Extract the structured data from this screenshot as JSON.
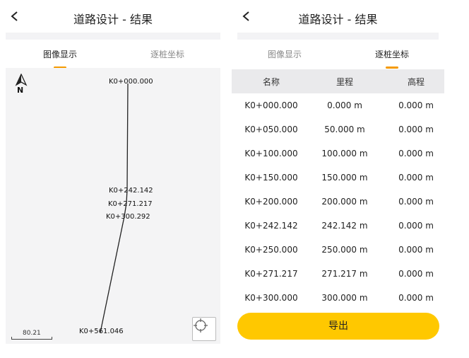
{
  "left": {
    "title": "道路设计 - 结果",
    "tabs": [
      {
        "label": "图像显示",
        "active": true
      },
      {
        "label": "逐桩坐标",
        "active": false
      }
    ],
    "map": {
      "north_label": "N",
      "stations": [
        {
          "label": "K0+000.000"
        },
        {
          "label": "K0+242.142"
        },
        {
          "label": "K0+271.217"
        },
        {
          "label": "K0+300.292"
        },
        {
          "label": "K0+561.046"
        }
      ],
      "scale_value": "80.21",
      "locate_icon": "crosshair-icon"
    }
  },
  "right": {
    "title": "道路设计 - 结果",
    "tabs": [
      {
        "label": "图像显示",
        "active": false
      },
      {
        "label": "逐桩坐标",
        "active": true
      }
    ],
    "table": {
      "headers": [
        "名称",
        "里程",
        "高程"
      ],
      "rows": [
        [
          "K0+000.000",
          "0.000 m",
          "0.000 m"
        ],
        [
          "K0+050.000",
          "50.000 m",
          "0.000 m"
        ],
        [
          "K0+100.000",
          "100.000 m",
          "0.000 m"
        ],
        [
          "K0+150.000",
          "150.000 m",
          "0.000 m"
        ],
        [
          "K0+200.000",
          "200.000 m",
          "0.000 m"
        ],
        [
          "K0+242.142",
          "242.142 m",
          "0.000 m"
        ],
        [
          "K0+250.000",
          "250.000 m",
          "0.000 m"
        ],
        [
          "K0+271.217",
          "271.217 m",
          "0.000 m"
        ],
        [
          "K0+300.000",
          "300.000 m",
          "0.000 m"
        ]
      ]
    },
    "export_label": "导出"
  },
  "colors": {
    "accent": "#f59a00",
    "export_button": "#ffc800",
    "map_background": "#f4f4f5",
    "table_header": "#eaeaec"
  }
}
